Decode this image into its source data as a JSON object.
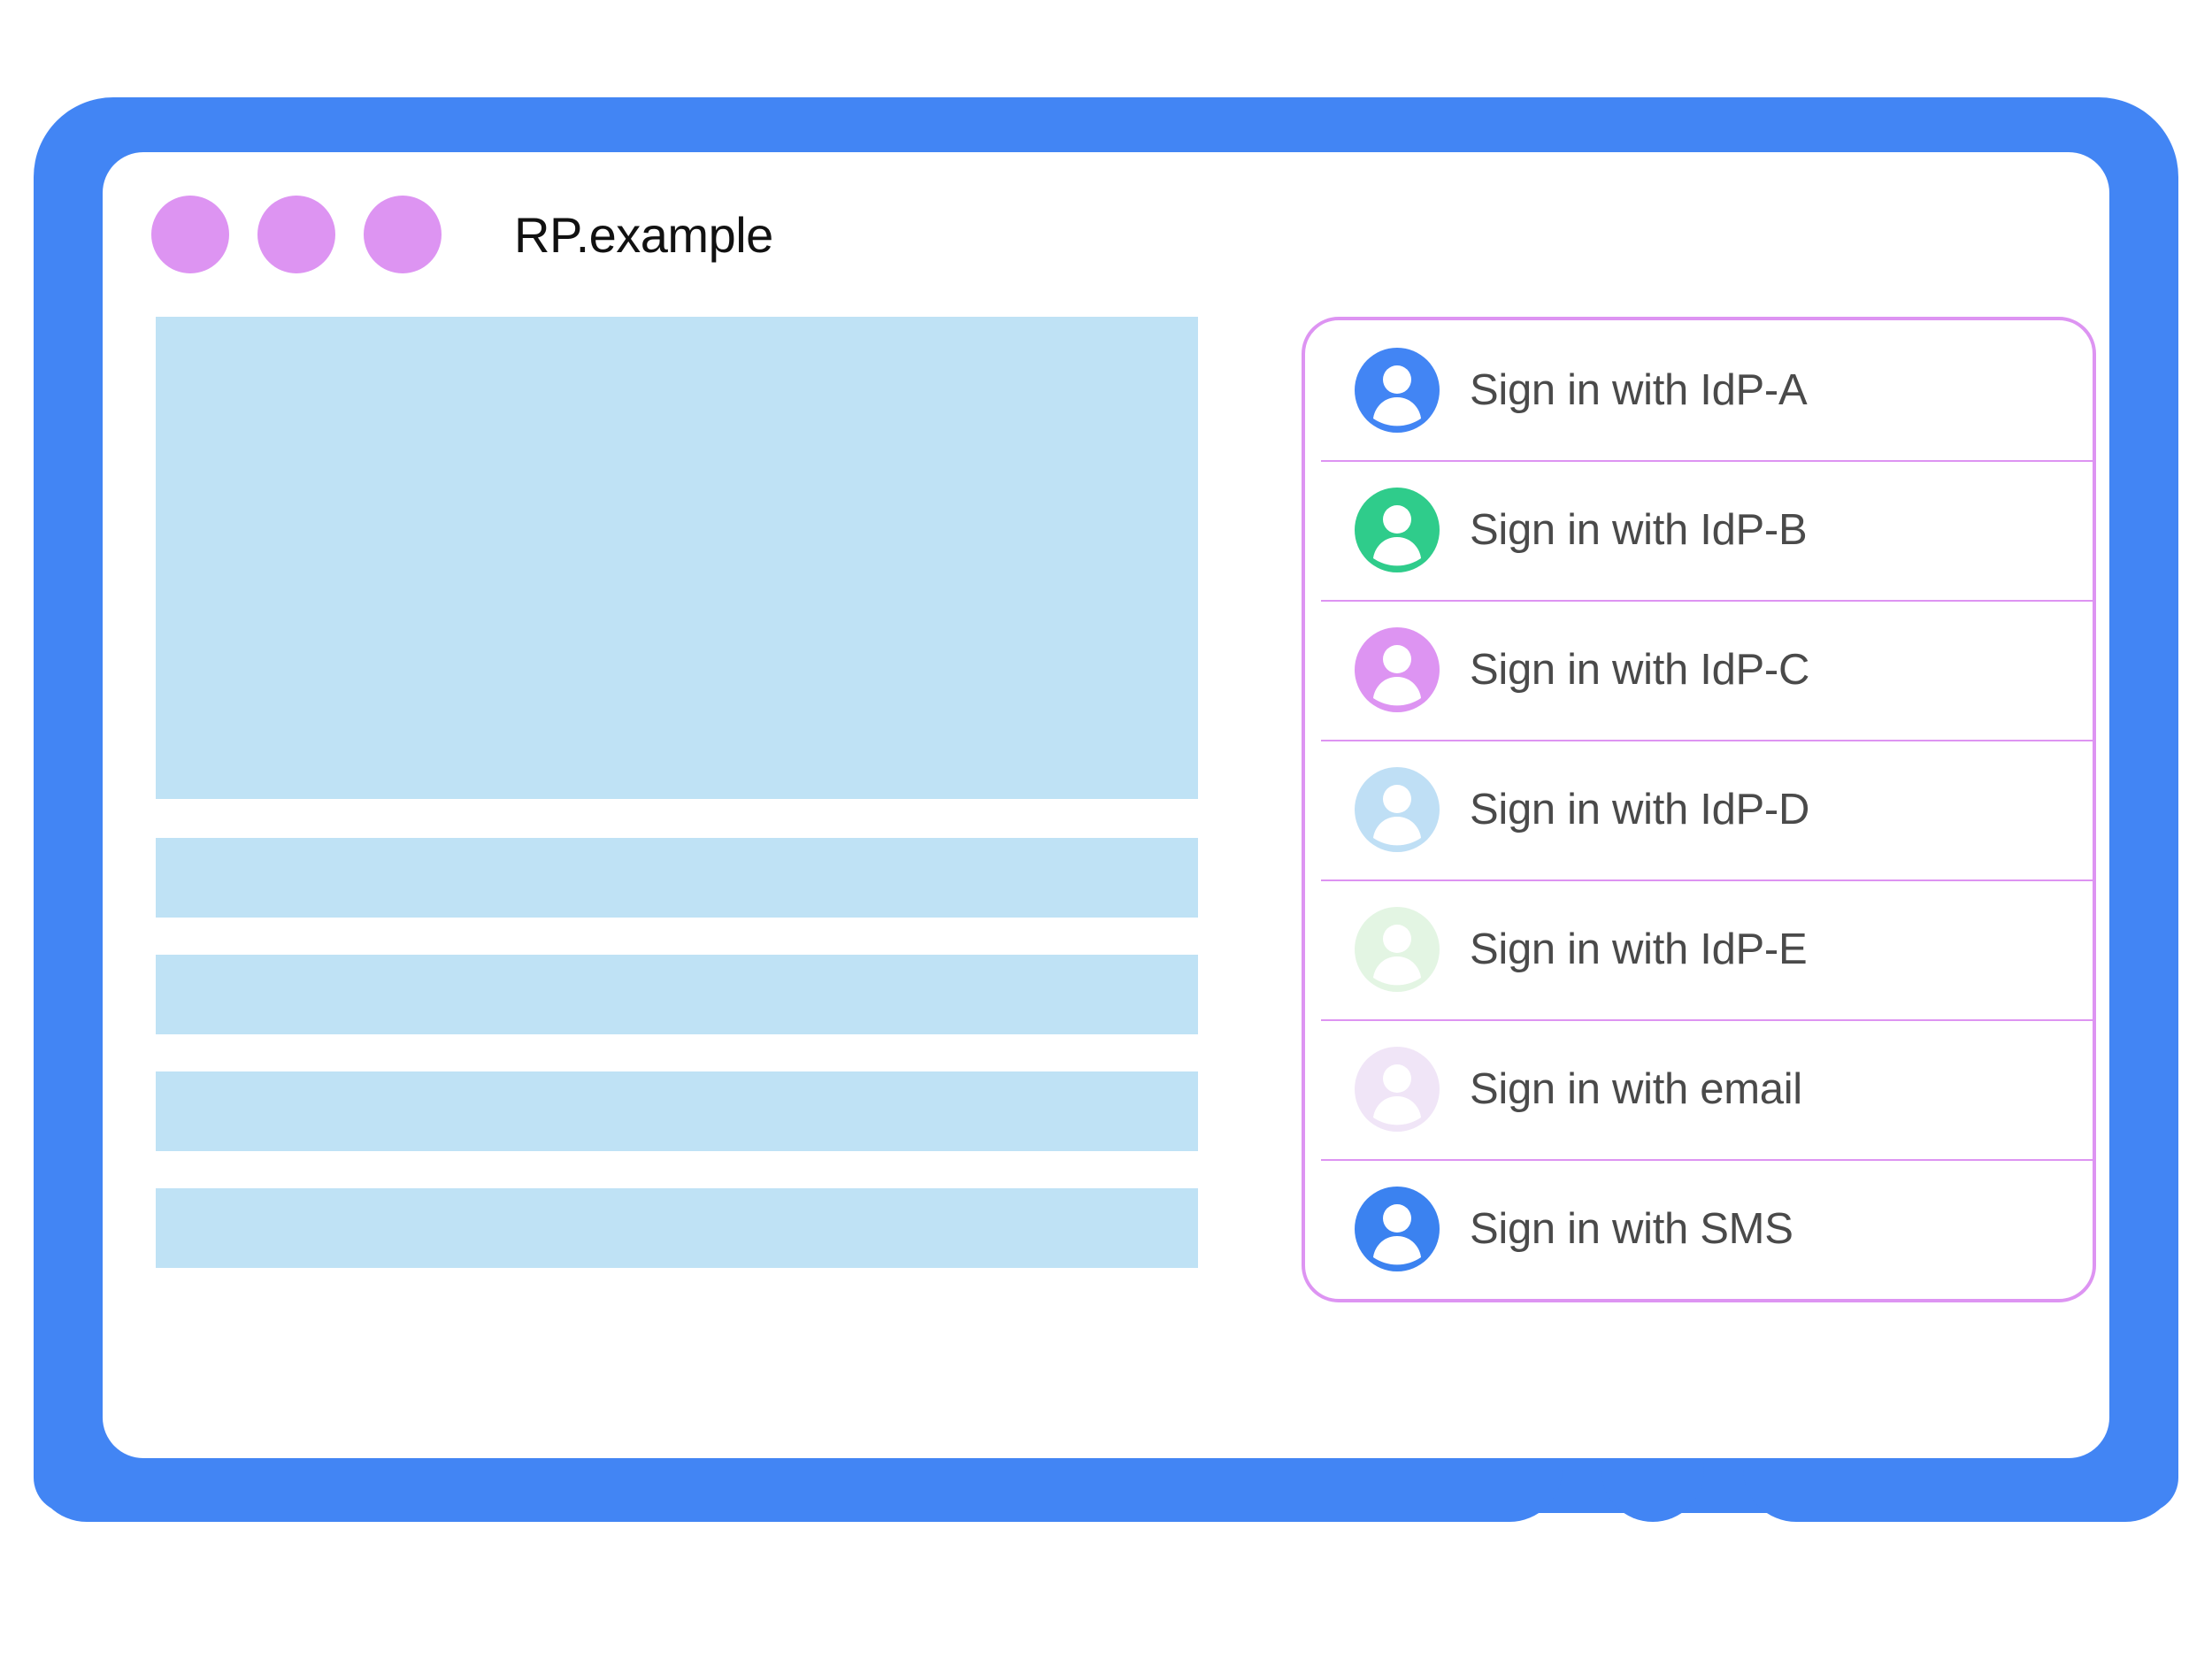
{
  "window": {
    "title": "RP.example",
    "dots": [
      {
        "name": "window-dot-1",
        "color": "#dd94f2"
      },
      {
        "name": "window-dot-2",
        "color": "#dd94f2"
      },
      {
        "name": "window-dot-3",
        "color": "#dd94f2"
      }
    ]
  },
  "frame": {
    "color": "#4285f4",
    "home_button": "home-button"
  },
  "content_blocks": [
    {
      "name": "content-hero-block",
      "kind": "hero",
      "color": "#bfe2f5"
    },
    {
      "name": "content-bar-block-1",
      "kind": "bar",
      "color": "#bfe2f5"
    },
    {
      "name": "content-bar-block-2",
      "kind": "bar",
      "color": "#bfe2f5"
    },
    {
      "name": "content-bar-block-3",
      "kind": "bar",
      "color": "#bfe2f5"
    },
    {
      "name": "content-bar-block-4",
      "kind": "bar",
      "color": "#bfe2f5"
    }
  ],
  "account_panel": {
    "border_color": "#dd94f2",
    "divider_color": "#dd94f2",
    "text_color": "#4a4a4a",
    "items": [
      {
        "label": "Sign in with IdP-A",
        "avatar_color": "#4285f4",
        "icon": "person-avatar-icon"
      },
      {
        "label": "Sign in with IdP-B",
        "avatar_color": "#2fcc8b",
        "icon": "person-avatar-icon"
      },
      {
        "label": "Sign in with IdP-C",
        "avatar_color": "#dd94f2",
        "icon": "person-avatar-icon"
      },
      {
        "label": "Sign in with IdP-D",
        "avatar_color": "#bfdff5",
        "icon": "person-avatar-icon"
      },
      {
        "label": "Sign in with IdP-E",
        "avatar_color": "#e3f5e3",
        "icon": "person-avatar-icon"
      },
      {
        "label": "Sign in with email",
        "avatar_color": "#f0e5f7",
        "icon": "person-avatar-icon"
      },
      {
        "label": "Sign in with SMS",
        "avatar_color": "#3b82f0",
        "icon": "person-avatar-icon"
      }
    ]
  }
}
